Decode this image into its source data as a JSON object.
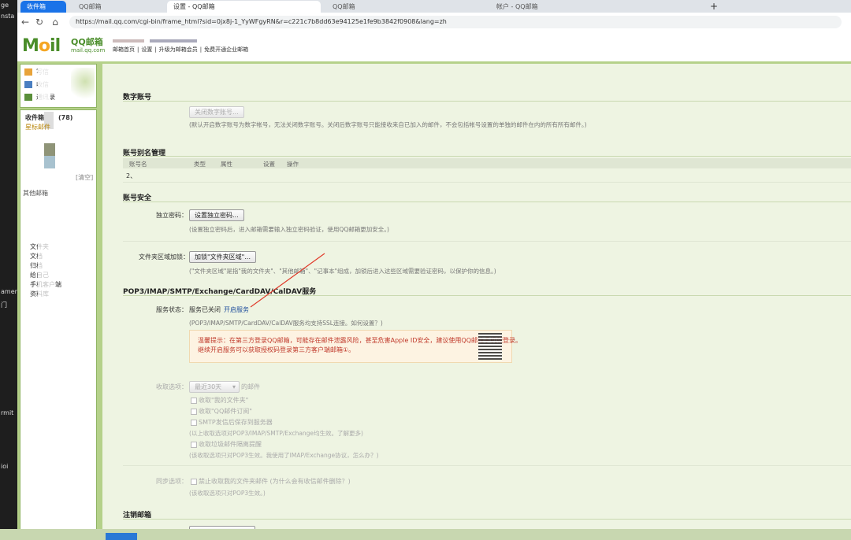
{
  "left_strip": {
    "fragments": [
      "ge",
      "nsta",
      "amen",
      "il",
      "rmit",
      "ioi",
      "门"
    ]
  },
  "tabs": [
    {
      "label": "收件箱",
      "state": "blue"
    },
    {
      "label": "QQ邮箱",
      "state": "normal"
    },
    {
      "label": "设置 - QQ邮箱",
      "state": "active"
    },
    {
      "label": "QQ邮箱",
      "state": "normal"
    },
    {
      "label": "帐户 - QQ邮箱",
      "state": "normal"
    }
  ],
  "address_bar": {
    "url": "https://mail.qq.com/cgi-bin/frame_html?sid=0jx8j-1_YyWFgyRN&r=c221c7b8dd63e94125e1fe9b3842f0908&lang=zh"
  },
  "header": {
    "logo_letters": "M",
    "logo_o": "o",
    "logo_rest": "il",
    "logo_cn": "QQ邮箱",
    "logo_domain": "mail.qq.com",
    "links": [
      "邮箱首页",
      "|",
      "设置",
      "|",
      "升级为邮箱会员",
      "|",
      "免费开通企业邮箱"
    ]
  },
  "sidebar": {
    "top_items": [
      "写信",
      "收信",
      "通讯录"
    ],
    "inbox_label": "收件箱",
    "inbox_count": "(78)",
    "star_label": "星标邮件",
    "clear_label": "[清空]",
    "folders": [
      "文件夹",
      "文档",
      "归档",
      "给自己",
      "手机客户端",
      "资料库"
    ],
    "section_label": "其他邮箱"
  },
  "sections": {
    "digital": {
      "title": "数字账号",
      "button": "关闭数字账号...",
      "note": "(默认开启数字账号为数字帐号，无法关闭数字账号。关闭后数字账号只能接收来自已加入的邮件，不会包括帐号设置的单独的邮件在内的所有所有邮件。)"
    },
    "alias": {
      "title": "账号别名管理",
      "headers": [
        "账号名",
        "类型",
        "属性",
        "设置",
        "操作"
      ],
      "row_index": "2、"
    },
    "security": {
      "title": "账号安全",
      "pwd_label": "独立密码：",
      "pwd_button": "设置独立密码...",
      "pwd_note": "(设置独立密码后，进入邮箱需要输入独立密码验证，使用QQ邮箱更加安全。)",
      "folder_label": "文件夹区域加锁：",
      "folder_button": "加锁\"文件夹区域\"...",
      "folder_note": "(\"文件夹区域\"是指\"我的文件夹\"、\"其他邮箱\"、\"记事本\"组成，加锁后进入这些区域需要验证密码，以保护你的信息。)"
    },
    "pop3": {
      "title": "POP3/IMAP/SMTP/Exchange/CardDAV/CalDAV服务",
      "status_label": "服务状态：",
      "status_value": "服务已关闭",
      "enable_link": "开启服务",
      "note": "(POP3/IMAP/SMTP/CardDAV/CalDAV服务均支持SSL连接。如何设置？)",
      "tip_line1": "温馨提示：在第三方登录QQ邮箱，可能存在邮件泄露风险，甚至危害Apple ID安全，建议使用QQ邮箱手机版登录。",
      "tip_line2": "继续开启服务可以获取授权码登录第三方客户端邮箱①。",
      "recv_label": "收取选项：",
      "recv_select": "最近30天",
      "recv_suffix": "的邮件",
      "opt1": "收取\"我的文件夹\"",
      "opt2": "收取\"QQ邮件订阅\"",
      "opt3": "SMTP发信后保存到服务器",
      "opt_note": "(以上收取选项对POP3/IMAP/SMTP/Exchange均生效。了解更多)",
      "opt4": "收取垃圾邮件隔离提醒",
      "opt4_note": "(该收取选项只对POP3生效。我使用了IMAP/Exchange协议，怎么办？)",
      "sync_label": "同步选项：",
      "sync_opt": "禁止收取我的文件夹邮件 (为什么会有收信邮件删除？)",
      "sync_note": "(该收取选项只对POP3生效。)"
    },
    "cancel": {
      "title": "注销邮箱"
    }
  }
}
